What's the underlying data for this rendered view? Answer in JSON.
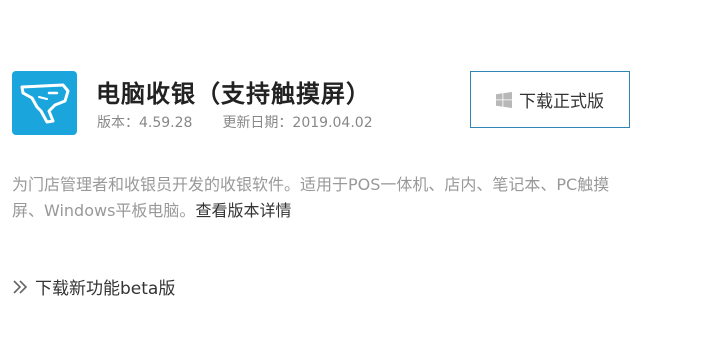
{
  "app": {
    "icon": "cheetah-logo-icon",
    "title": "电脑收银（支持触摸屏）",
    "version": "版本：4.59.28",
    "updated": "更新日期：2019.04.02"
  },
  "download": {
    "label": "下载正式版",
    "icon": "windows-icon"
  },
  "description": {
    "text": "为门店管理者和收银员开发的收银软件。适用于POS一体机、店内、笔记本、PC触摸屏、Windows平板电脑。",
    "detail_link": "查看版本详情"
  },
  "beta": {
    "icon": "double-chevron-right-icon",
    "label": "下载新功能beta版"
  },
  "colors": {
    "icon_bg": "#1aa6dd",
    "button_border": "#2f86b6"
  }
}
